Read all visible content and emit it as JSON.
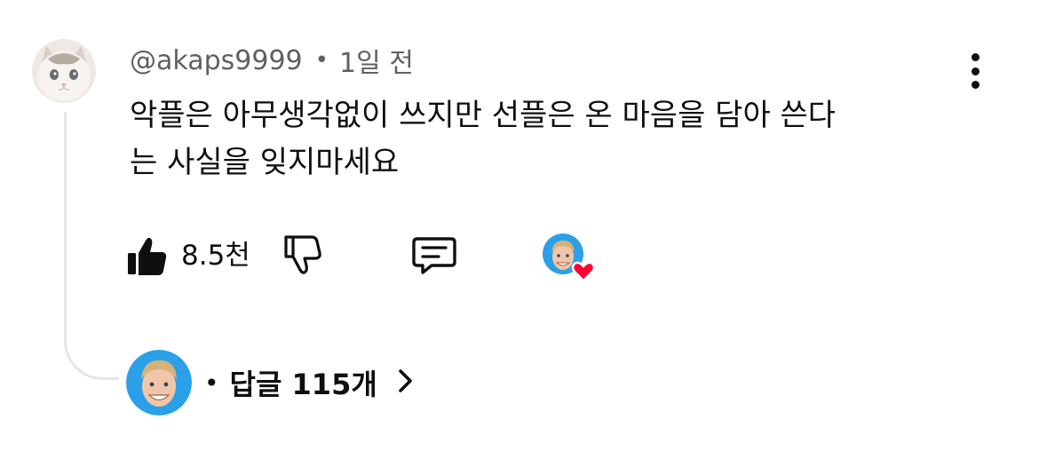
{
  "comment": {
    "author": "@akaps9999",
    "separator": "•",
    "time": "1일 전",
    "text_line1": "악플은 아무생각없이 쓰지만 선플은 온 마음을 담아 쓴다",
    "text_line2": "는 사실을 잊지마세요",
    "avatar_icon": "cat-avatar"
  },
  "actions": {
    "like_count": "8.5천",
    "like_icon": "thumbs-up-filled-icon",
    "dislike_icon": "thumbs-down-outline-icon",
    "reply_icon": "comment-icon",
    "creator_heart_icon": "creator-heart-icon",
    "heart_color": "#ff0033"
  },
  "replies": {
    "separator": "•",
    "label": "답글 115개",
    "chevron_icon": "chevron-right-icon"
  },
  "colors": {
    "text_primary": "#0f0f0f",
    "text_secondary": "#606060",
    "thread_line": "#e5e5e5",
    "creator_avatar_bg": "#2aa0e8"
  }
}
